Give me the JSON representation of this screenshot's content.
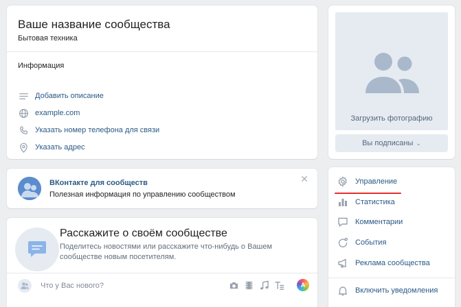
{
  "group": {
    "name": "Ваше название сообщества",
    "status": "Бытовая техника",
    "info_header": "Информация",
    "info_rows": [
      {
        "icon": "lines-icon",
        "label": "Добавить описание"
      },
      {
        "icon": "globe-icon",
        "label": "example.com"
      },
      {
        "icon": "phone-icon",
        "label": "Указать номер телефона для связи"
      },
      {
        "icon": "location-pin-icon",
        "label": "Указать адрес"
      }
    ]
  },
  "photo": {
    "upload_label": "Загрузить фотографию",
    "subscribed_label": "Вы подписаны",
    "subscribed_chevron": "⌄"
  },
  "promo": {
    "title": "ВКонтакте для сообществ",
    "text": "Полезная информация по управлению сообществом",
    "close_glyph": "✕"
  },
  "about": {
    "title": "Расскажите о своём сообществе",
    "description": "Поделитесь новостями или расскажите что-нибудь о Вашем сообществе новым посетителям.",
    "post_placeholder": "Что у Вас нового?",
    "tools": [
      "camera-icon",
      "video-icon",
      "music-icon",
      "text-format-icon"
    ],
    "color_tool_glyph": "A"
  },
  "menu": {
    "items": [
      {
        "icon": "gear-icon",
        "label": "Управление"
      },
      {
        "icon": "bar-chart-icon",
        "label": "Статистика"
      },
      {
        "icon": "comment-icon",
        "label": "Комментарии"
      },
      {
        "icon": "events-icon",
        "label": "События"
      },
      {
        "icon": "megaphone-icon",
        "label": "Реклама сообщества"
      },
      {
        "icon": "bell-icon",
        "label": "Включить уведомления"
      }
    ],
    "highlight_color": "#e42d2d"
  },
  "colors": {
    "background": "#edeef0",
    "link": "#2a5885",
    "secondary_text": "#55677d",
    "accent_blue": "#5181b8",
    "icon_gray": "#99a2ad"
  }
}
